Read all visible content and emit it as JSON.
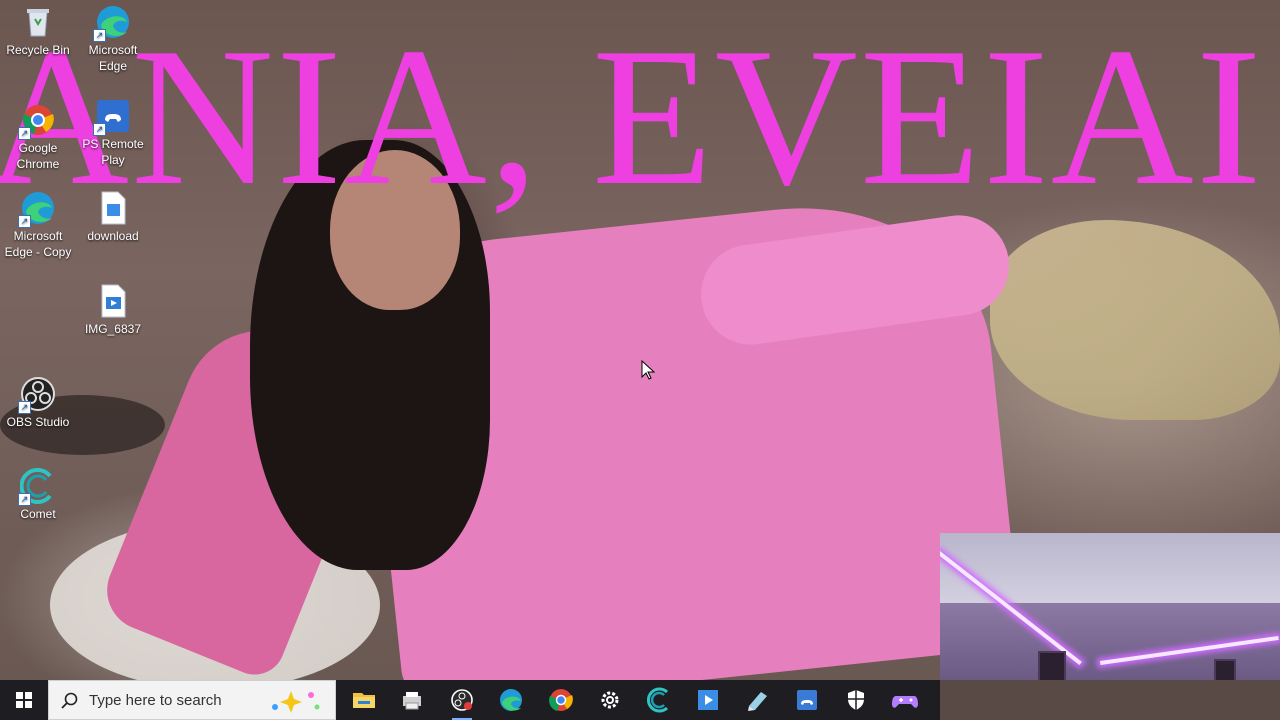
{
  "overlay": {
    "text": "ANIA, EVEIAI"
  },
  "desktop_icons": [
    {
      "label": "Recycle Bin",
      "icon": "recycle-bin-icon"
    },
    {
      "label": "Microsoft Edge",
      "icon": "edge-icon"
    },
    {
      "label": "Google Chrome",
      "icon": "chrome-icon"
    },
    {
      "label": "PS Remote Play",
      "icon": "ps-remote-play-icon"
    },
    {
      "label": "Microsoft Edge - Copy",
      "icon": "edge-icon"
    },
    {
      "label": "download",
      "icon": "image-file-icon"
    },
    {
      "label": "IMG_6837",
      "icon": "video-file-icon"
    },
    {
      "label": "OBS Studio",
      "icon": "obs-icon"
    },
    {
      "label": "Comet",
      "icon": "comet-icon"
    }
  ],
  "taskbar": {
    "search_placeholder": "Type here to search",
    "pinned": [
      {
        "name": "file-explorer-icon",
        "color": "#f0c040"
      },
      {
        "name": "printer-icon",
        "color": "#d0d0d0"
      },
      {
        "name": "obs-recording-icon",
        "color": "#ffffff"
      },
      {
        "name": "edge-icon",
        "color": "#34b0e8"
      },
      {
        "name": "chrome-icon",
        "color": "#4caf50"
      },
      {
        "name": "settings-gear-icon",
        "color": "#ffffff"
      },
      {
        "name": "comet-icon",
        "color": "#2ec4c4"
      },
      {
        "name": "media-player-icon",
        "color": "#3a8ee6"
      },
      {
        "name": "notepad-icon",
        "color": "#9ad0e8"
      },
      {
        "name": "ps-remote-play-icon",
        "color": "#3a7bd5"
      },
      {
        "name": "security-shield-icon",
        "color": "#ffffff"
      },
      {
        "name": "game-controller-icon",
        "color": "#b47cff"
      }
    ]
  },
  "colors": {
    "overlay_text": "#ee3fe0",
    "taskbar_bg": "#1e1e22",
    "accent": "#7fb0ff"
  }
}
